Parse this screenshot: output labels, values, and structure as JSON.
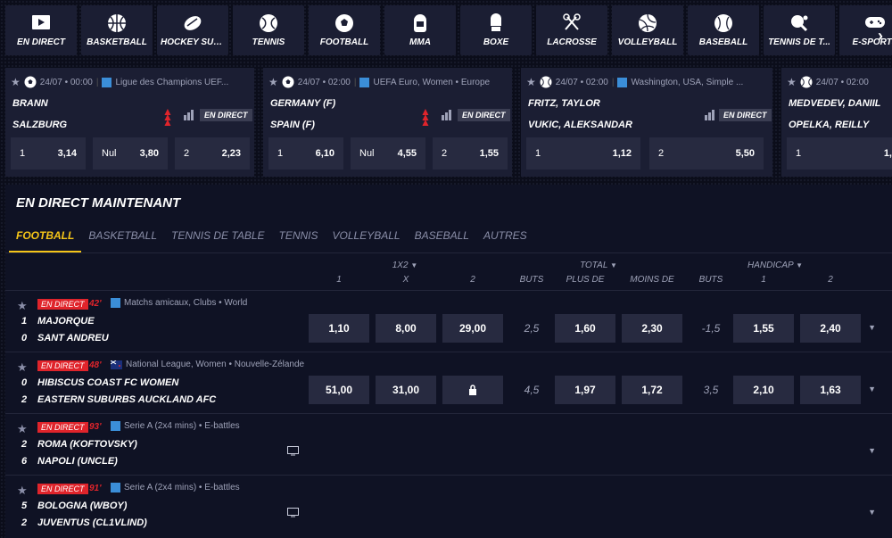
{
  "sports_nav": [
    {
      "label": "EN DIRECT",
      "icon": "play-icon"
    },
    {
      "label": "BASKETBALL",
      "icon": "basketball-icon"
    },
    {
      "label": "HOCKEY SUR...",
      "icon": "hockey-puck-icon"
    },
    {
      "label": "TENNIS",
      "icon": "tennis-ball-icon"
    },
    {
      "label": "FOOTBALL",
      "icon": "soccer-ball-icon"
    },
    {
      "label": "MMA",
      "icon": "helmet-icon"
    },
    {
      "label": "BOXE",
      "icon": "boxing-glove-icon"
    },
    {
      "label": "LACROSSE",
      "icon": "lacrosse-sticks-icon"
    },
    {
      "label": "VOLLEYBALL",
      "icon": "volleyball-icon"
    },
    {
      "label": "BASEBALL",
      "icon": "baseball-icon"
    },
    {
      "label": "TENNIS DE T...",
      "icon": "ping-pong-icon"
    },
    {
      "label": "E-SPORTS",
      "icon": "gamepad-icon"
    }
  ],
  "featured": [
    {
      "time": "24/07 • 00:00",
      "competition": "Ligue des Champions UEF...",
      "team1": "BRANN",
      "team2": "SALZBURG",
      "live": "EN DIRECT",
      "odds": [
        {
          "k": "1",
          "v": "3,14"
        },
        {
          "k": "Nul",
          "v": "3,80"
        },
        {
          "k": "2",
          "v": "2,23"
        }
      ]
    },
    {
      "time": "24/07 • 02:00",
      "competition": "UEFA Euro, Women • Europe",
      "team1": "GERMANY (F)",
      "team2": "SPAIN (F)",
      "live": "EN DIRECT",
      "odds": [
        {
          "k": "1",
          "v": "6,10"
        },
        {
          "k": "Nul",
          "v": "4,55"
        },
        {
          "k": "2",
          "v": "1,55"
        }
      ]
    },
    {
      "time": "24/07 • 02:00",
      "competition": "Washington, USA, Simple ...",
      "team1": "FRITZ, TAYLOR",
      "team2": "VUKIC, ALEKSANDAR",
      "live": "EN DIRECT",
      "odds": [
        {
          "k": "1",
          "v": "1,12"
        },
        {
          "k": "2",
          "v": "5,50"
        }
      ]
    },
    {
      "time": "24/07 • 02:00",
      "competition": "",
      "team1": "MEDVEDEV, DANIIL",
      "team2": "OPELKA, REILLY",
      "live": "",
      "odds": [
        {
          "k": "1",
          "v": "1,"
        }
      ]
    }
  ],
  "panel": {
    "title": "EN DIRECT MAINTENANT",
    "tabs": [
      "FOOTBALL",
      "BASKETBALL",
      "TENNIS DE TABLE",
      "TENNIS",
      "VOLLEYBALL",
      "BASEBALL",
      "AUTRES"
    ],
    "headers": {
      "group_1x2": "1X2",
      "total": "TOTAL",
      "handicap": "HANDICAP",
      "c1": "1",
      "cx": "X",
      "c2": "2",
      "buts": "BUTS",
      "plus": "PLUS DE",
      "moins": "MOINS DE",
      "buts2": "BUTS",
      "h1": "1",
      "h2": "2"
    }
  },
  "matches": [
    {
      "live": "EN DIRECT",
      "minute": "42'",
      "competition": "Matchs amicaux, Clubs • World",
      "s1": "1",
      "t1": "MAJORQUE",
      "s2": "0",
      "t2": "SANT ANDREU",
      "o1": "1,10",
      "ox": "8,00",
      "o2": "29,00",
      "goals": "2,5",
      "over": "1,60",
      "under": "2,30",
      "hcap": "-1,5",
      "h1": "1,55",
      "h2": "2,40"
    },
    {
      "live": "EN DIRECT",
      "minute": "48'",
      "competition": "National League, Women • Nouvelle-Zélande",
      "s1": "0",
      "t1": "HIBISCUS COAST FC WOMEN",
      "s2": "2",
      "t2": "EASTERN SUBURBS AUCKLAND AFC",
      "o1": "51,00",
      "ox": "31,00",
      "o2": "",
      "goals": "4,5",
      "over": "1,97",
      "under": "1,72",
      "hcap": "3,5",
      "h1": "2,10",
      "h2": "1,63"
    },
    {
      "live": "EN DIRECT",
      "minute": "93'",
      "competition": "Serie A (2x4 mins) • E-battles",
      "s1": "2",
      "t1": "ROMA (KOFTOVSKY)",
      "s2": "6",
      "t2": "NAPOLI (UNCLE)"
    },
    {
      "live": "EN DIRECT",
      "minute": "91'",
      "competition": "Serie A (2x4 mins) • E-battles",
      "s1": "5",
      "t1": "BOLOGNA (WBOY)",
      "s2": "2",
      "t2": "JUVENTUS (CL1VLIND)"
    }
  ],
  "colors": {
    "accent": "#f5c518",
    "live": "#e0242b",
    "panel": "#0f1224",
    "card": "#1b1e33",
    "cell": "#272a40"
  }
}
